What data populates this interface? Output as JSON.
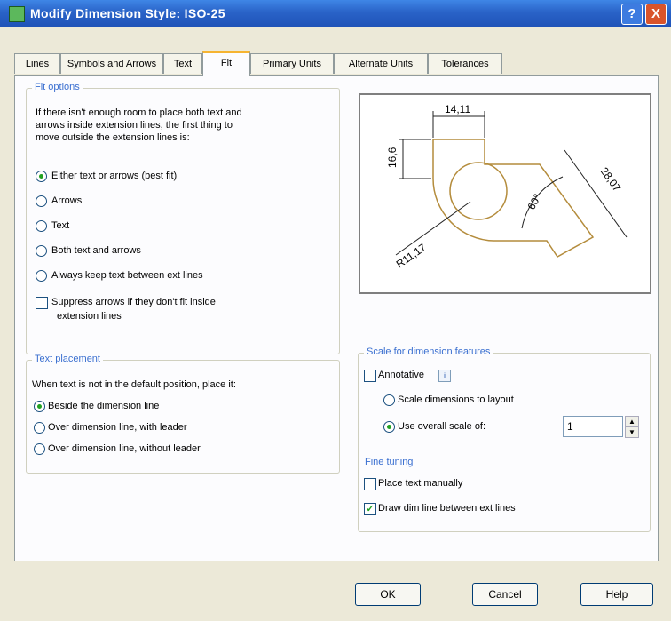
{
  "window": {
    "title": "Modify Dimension Style: ISO-25"
  },
  "tabs": [
    "Lines",
    "Symbols and Arrows",
    "Text",
    "Fit",
    "Primary Units",
    "Alternate Units",
    "Tolerances"
  ],
  "fit_options": {
    "title": "Fit options",
    "description": [
      "If there isn't enough room to place both text and",
      "arrows inside extension lines, the first thing to",
      "move outside the extension lines is:"
    ],
    "options": [
      "Either text or arrows (best fit)",
      "Arrows",
      "Text",
      "Both text and arrows",
      "Always keep text between ext lines"
    ],
    "selected_index": 0,
    "suppress_label": [
      "Suppress arrows if they don't fit inside",
      "extension lines"
    ],
    "suppress_checked": false
  },
  "text_placement": {
    "title": "Text placement",
    "prompt": "When text is not in the default position, place it:",
    "options": [
      "Beside the dimension line",
      "Over dimension line, with leader",
      "Over dimension line, without leader"
    ],
    "selected_index": 0
  },
  "preview": {
    "labels": {
      "top": "14,11",
      "left": "16,6",
      "angle": "60°",
      "diag": "28,07",
      "radius": "R11,17"
    }
  },
  "scale": {
    "title": "Scale for dimension features",
    "annotative_label": "Annotative",
    "annotative_checked": false,
    "info_icon": "i",
    "layout_label": "Scale dimensions to layout",
    "overall_label": "Use overall scale of:",
    "overall_value": "1",
    "spin_up": "▲",
    "spin_down": "▼"
  },
  "fine_tuning": {
    "title": "Fine tuning",
    "place_manual_label": "Place text manually",
    "place_manual_checked": false,
    "draw_dim_label": "Draw dim line between ext lines",
    "draw_dim_checked": true,
    "check_mark": "✓"
  },
  "buttons": {
    "ok": "OK",
    "cancel": "Cancel",
    "help": "Help"
  },
  "title_buttons": {
    "help": "?",
    "close": "X"
  }
}
